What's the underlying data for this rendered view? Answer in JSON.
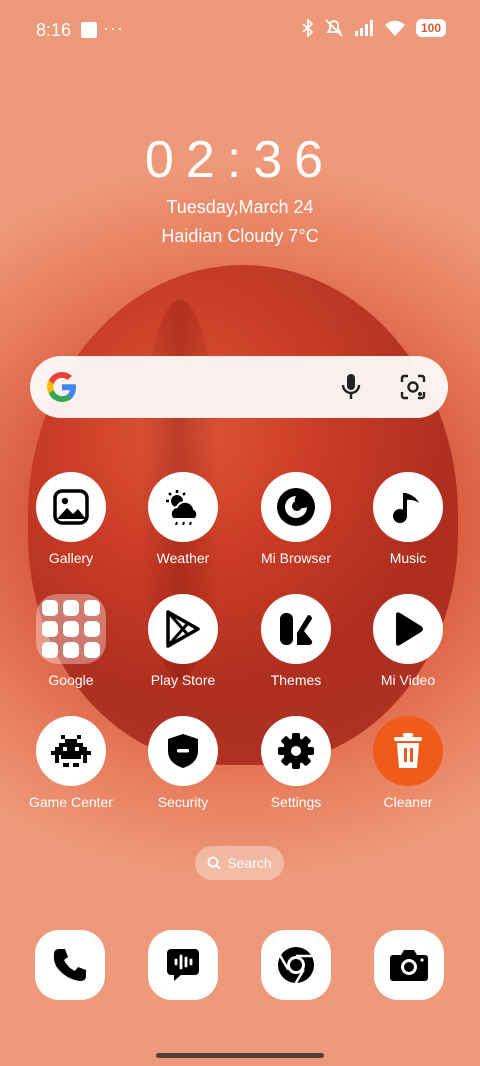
{
  "status_bar": {
    "time": "8:16",
    "more": "···",
    "battery": "100"
  },
  "lock_info": {
    "clock": "02:36",
    "date": "Tuesday,March 24",
    "weather": "Haidian Cloudy 7°C"
  },
  "apps": [
    {
      "label": "Gallery",
      "icon": "gallery-icon"
    },
    {
      "label": "Weather",
      "icon": "weather-icon"
    },
    {
      "label": "Mi Browser",
      "icon": "browser-icon"
    },
    {
      "label": "Music",
      "icon": "music-icon"
    },
    {
      "label": "Google",
      "icon": "folder-icon"
    },
    {
      "label": "Play Store",
      "icon": "play-store-icon"
    },
    {
      "label": "Themes",
      "icon": "themes-icon"
    },
    {
      "label": "Mi Video",
      "icon": "video-icon"
    },
    {
      "label": "Game Center",
      "icon": "game-icon"
    },
    {
      "label": "Security",
      "icon": "shield-icon"
    },
    {
      "label": "Settings",
      "icon": "gear-icon"
    },
    {
      "label": "Cleaner",
      "icon": "trash-icon"
    }
  ],
  "app_search": {
    "label": "Search"
  },
  "dock": [
    "phone-icon",
    "messages-icon",
    "chrome-icon",
    "camera-icon"
  ],
  "colors": {
    "accent": "#f05a1a",
    "wallpaper": "#d8553a"
  }
}
